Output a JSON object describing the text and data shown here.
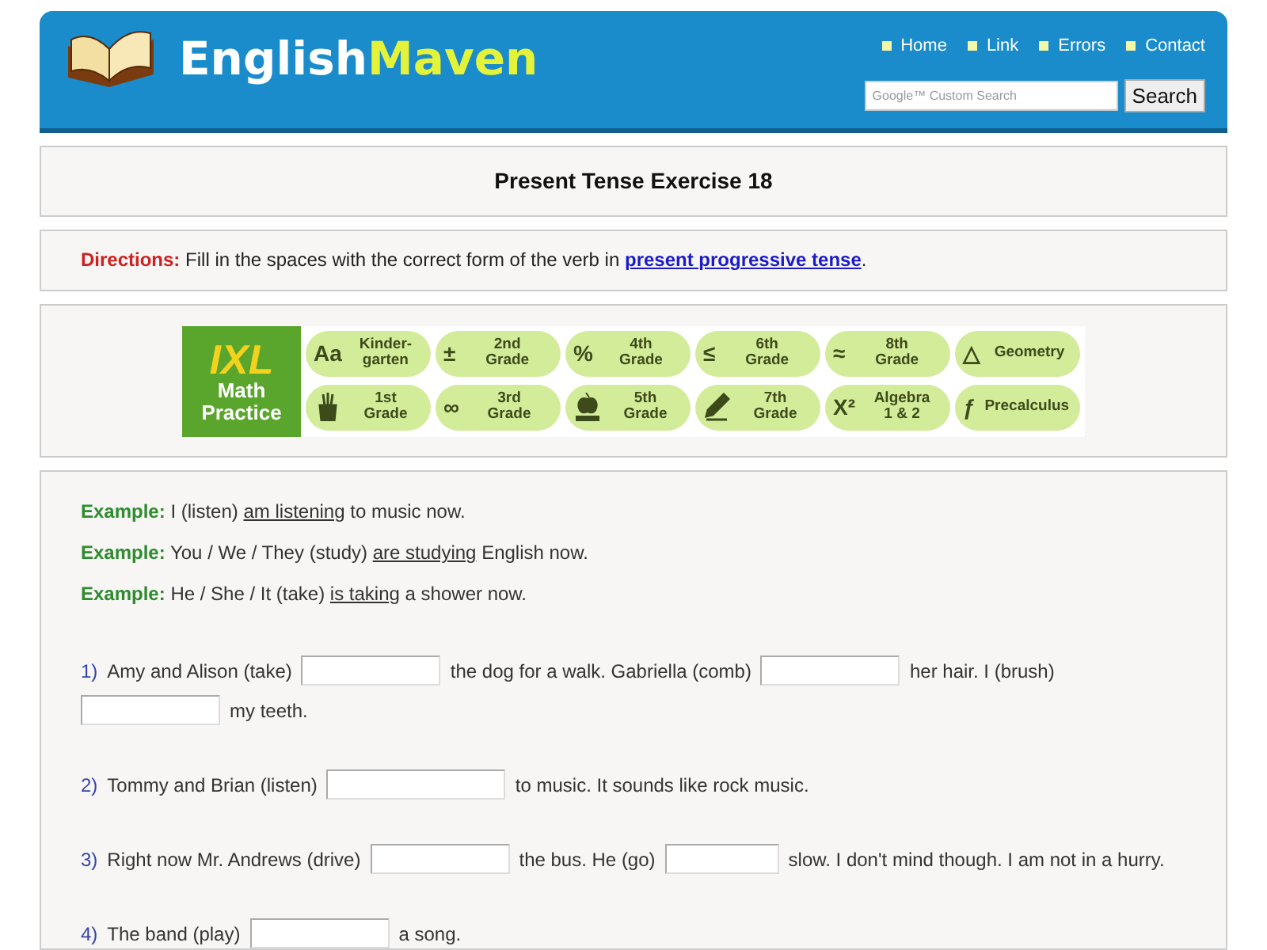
{
  "header": {
    "logo_first": "English",
    "logo_second": "Maven",
    "nav": [
      "Home",
      "Link",
      "Errors",
      "Contact"
    ],
    "search": {
      "placeholder": "Google™ Custom Search",
      "button": "Search"
    }
  },
  "title": "Present Tense Exercise 18",
  "directions": {
    "label": "Directions:",
    "text": "Fill in the spaces with the correct form of the verb in",
    "link": "present progressive tense",
    "end": "."
  },
  "ad": {
    "brand": "IXL",
    "subtitle": "Math Practice",
    "buttons": [
      {
        "kind": "symbol",
        "symbol": "Aa",
        "label": "Kinder-garten"
      },
      {
        "kind": "symbol",
        "symbol": "±",
        "label": "2nd Grade"
      },
      {
        "kind": "symbol",
        "symbol": "%",
        "label": "4th Grade"
      },
      {
        "kind": "symbol",
        "symbol": "≤",
        "label": "6th Grade"
      },
      {
        "kind": "symbol",
        "symbol": "≈",
        "label": "8th Grade"
      },
      {
        "kind": "symbol",
        "symbol": "△",
        "label": "Geometry"
      },
      {
        "kind": "cup",
        "label": "1st Grade"
      },
      {
        "kind": "symbol",
        "symbol": "∞",
        "label": "3rd Grade"
      },
      {
        "kind": "apple",
        "label": "5th Grade"
      },
      {
        "kind": "pencil",
        "label": "7th Grade"
      },
      {
        "kind": "symbol",
        "symbol": "X²",
        "label": "Algebra 1 & 2"
      },
      {
        "kind": "symbol",
        "symbol": "ƒ",
        "label": "Precalculus"
      }
    ]
  },
  "examples": [
    {
      "label": "Example:",
      "before": "I (listen)",
      "answer": "am listening",
      "after": "to music now."
    },
    {
      "label": "Example:",
      "before": "You / We / They (study)",
      "answer": "are studying",
      "after": "English now."
    },
    {
      "label": "Example:",
      "before": "He / She / It (take)",
      "answer": "is taking",
      "after": "a shower now."
    }
  ],
  "questions": [
    {
      "number": "1)",
      "parts": [
        {
          "kind": "text",
          "text": "Amy and Alison (take)"
        },
        {
          "kind": "blank"
        },
        {
          "kind": "text",
          "text": "the dog for a walk. Gabriella (comb)"
        },
        {
          "kind": "blank"
        },
        {
          "kind": "text",
          "text": "her hair. I (brush)"
        },
        {
          "kind": "blank"
        },
        {
          "kind": "text",
          "text": "my teeth."
        }
      ]
    },
    {
      "number": "2)",
      "parts": [
        {
          "kind": "text",
          "text": "Tommy and Brian (listen)"
        },
        {
          "kind": "blank",
          "wide": true
        },
        {
          "kind": "text",
          "text": "to music. It sounds like rock music."
        }
      ]
    },
    {
      "number": "3)",
      "parts": [
        {
          "kind": "text",
          "text": "Right now Mr. Andrews (drive)"
        },
        {
          "kind": "blank"
        },
        {
          "kind": "text",
          "text": "the bus. He (go)"
        },
        {
          "kind": "blank",
          "short": true
        },
        {
          "kind": "text",
          "text": "slow. I don't mind though. I am not in a hurry."
        }
      ]
    },
    {
      "number": "4)",
      "parts": [
        {
          "kind": "text",
          "text": "The band (play)"
        },
        {
          "kind": "blank"
        },
        {
          "kind": "text",
          "text": "a song."
        }
      ]
    }
  ]
}
